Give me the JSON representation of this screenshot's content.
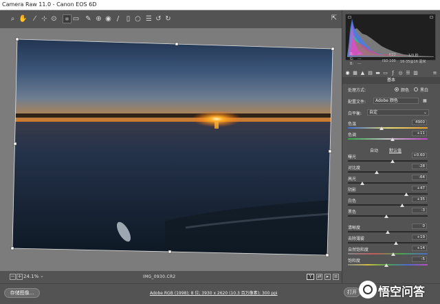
{
  "window": {
    "title": "Camera Raw 11.0  -  Canon EOS 6D"
  },
  "toolbar": {
    "tools": [
      "zoom-tool-icon",
      "hand-tool-icon",
      "white-balance-icon",
      "color-sampler-icon",
      "targeted-adjust-icon",
      "crop-icon",
      "straighten-icon",
      "spot-removal-icon",
      "red-eye-icon",
      "adjustment-brush-icon",
      "graduated-filter-icon",
      "radial-filter-icon",
      "presets-list-icon",
      "rotate-ccw-icon",
      "rotate-cw-icon"
    ],
    "fullscreen_icon": "fullscreen-icon"
  },
  "status": {
    "zoom_out_label": "−",
    "zoom_in_label": "+",
    "zoom": "24.1%",
    "filename": "IMG_0930.CR2",
    "view_label": "Y"
  },
  "bottom": {
    "save_label": "存储图像...",
    "workflow_link": "Adobe RGB (1998); 8 位; 3930 x 2620 (10.3 百万像素); 300 ppi",
    "open_label": "打开"
  },
  "watermark": {
    "text": "悟空问答"
  },
  "histogram": {
    "r_label": "R:",
    "g_label": "G:",
    "b_label": "B:",
    "r": "---",
    "g": "---",
    "b": "---",
    "exif_aperture": "f/22",
    "exif_shutter": "1/3 秒",
    "exif_iso": "ISO 100",
    "exif_lens": "16-35@16 毫米"
  },
  "panel": {
    "tabs": [
      "basic-icon",
      "tone-curve-icon",
      "detail-icon",
      "hsl-icon",
      "split-toning-icon",
      "lens-icon",
      "fx-icon",
      "calibration-icon",
      "presets-icon",
      "snapshots-icon"
    ],
    "title": "基本",
    "treatment_label": "处理方式:",
    "color_label": "颜色",
    "bw_label": "黑白",
    "profile_label": "配置文件:",
    "profile_value": "Adobe 颜色",
    "wb_label": "白平衡:",
    "wb_value": "自定",
    "auto_label": "自动",
    "default_label": "默认值",
    "sliders": [
      {
        "label": "色温",
        "value": "4900",
        "pos": 0.42
      },
      {
        "label": "色调",
        "value": "+11",
        "pos": 0.56
      },
      {
        "label": "曝光",
        "value": "+0.60",
        "pos": 0.56
      },
      {
        "label": "对比度",
        "value": "-28",
        "pos": 0.36
      },
      {
        "label": "高光",
        "value": "-64",
        "pos": 0.18
      },
      {
        "label": "阴影",
        "value": "+47",
        "pos": 0.73
      },
      {
        "label": "白色",
        "value": "+35",
        "pos": 0.68
      },
      {
        "label": "黑色",
        "value": "-3",
        "pos": 0.48
      },
      {
        "label": "清晰度",
        "value": "0",
        "pos": 0.5
      },
      {
        "label": "去除薄雾",
        "value": "+19",
        "pos": 0.6
      },
      {
        "label": "自然饱和度",
        "value": "+14",
        "pos": 0.57
      },
      {
        "label": "饱和度",
        "value": "-5",
        "pos": 0.48
      }
    ]
  }
}
